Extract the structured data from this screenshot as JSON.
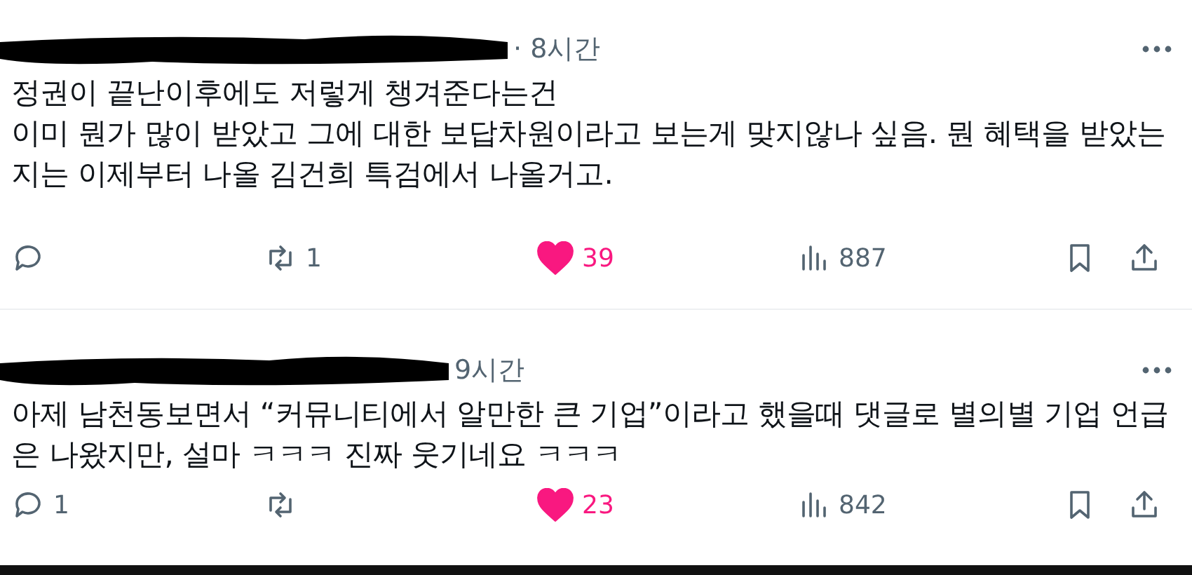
{
  "posts": [
    {
      "time": "· 8시간",
      "text": [
        "정권이 끝난이후에도 저렇게 챙겨준다는건",
        "이미 뭔가 많이 받았고 그에 대한 보답차원이라고 보는게 맞지않나 싶음. 뭔 혜택을 받았는지는 이제부터 나올 김건희 특검에서 나올거고."
      ],
      "actions": {
        "reposts": "1",
        "likes": "39",
        "liked": true,
        "views": "887"
      }
    },
    {
      "time": "9시간",
      "text": [
        "아제 남천동보면서 “커뮤니티에서 알만한 큰 기업”이라고 했을때 댓글로 별의별 기업 언급은 나왔지만, 설마 ㅋㅋㅋ 진짜 웃기네요 ㅋㅋㅋ"
      ],
      "actions": {
        "replies": "1",
        "likes": "23",
        "liked": true,
        "views": "842"
      }
    }
  ]
}
